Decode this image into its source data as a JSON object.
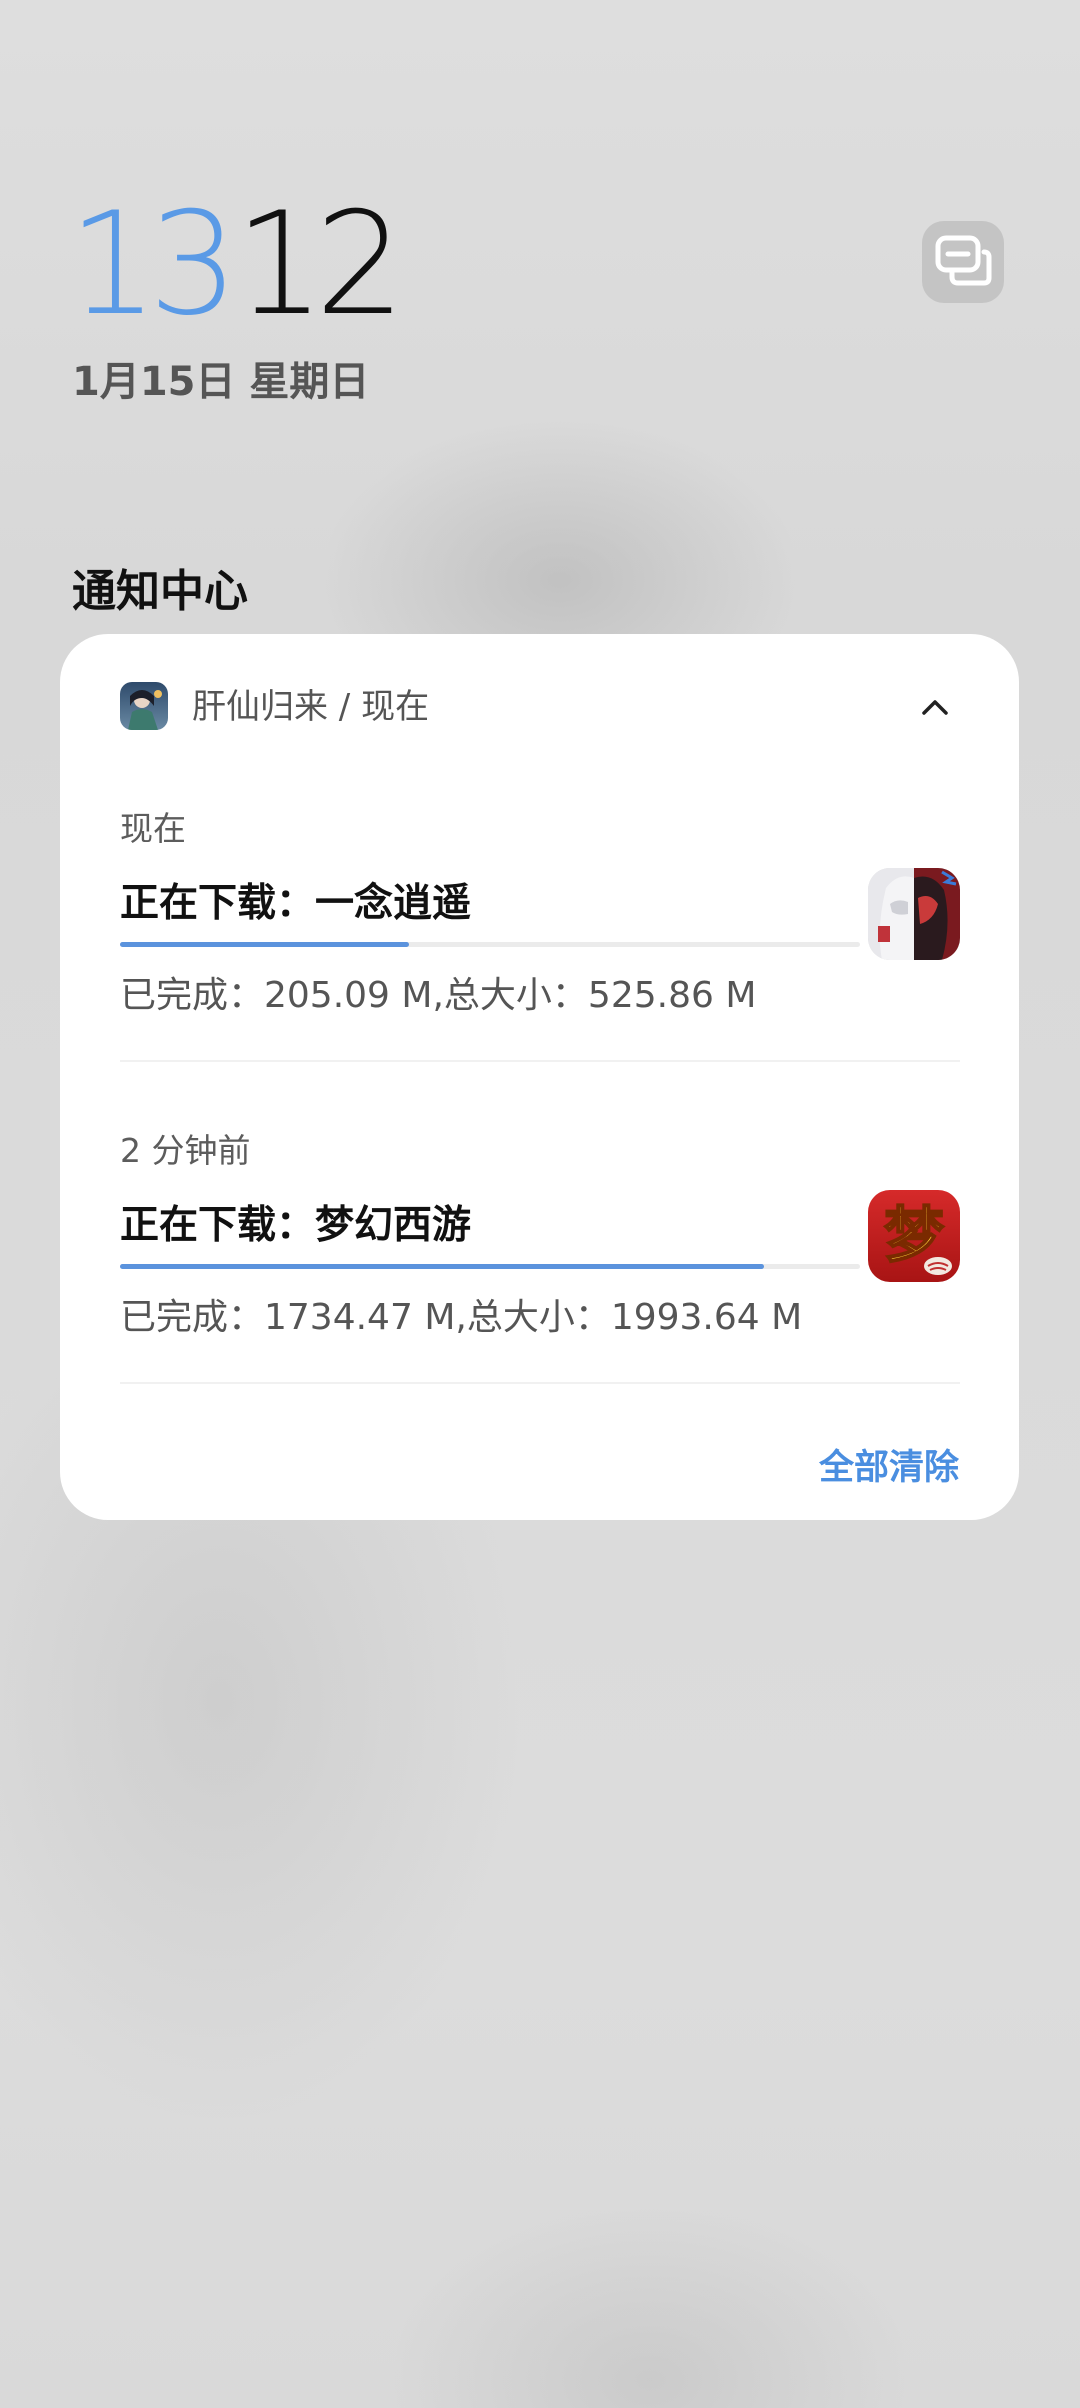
{
  "lockscreen": {
    "clock_hours": "13",
    "clock_minutes": "12",
    "date": "1月15日 星期日",
    "notification_center_title": "通知中心"
  },
  "notification_group": {
    "header_text": "肝仙归来 / 现在",
    "items": [
      {
        "time": "现在",
        "title": "正在下载：一念逍遥",
        "progress": 0.39,
        "detail": "已完成：205.09 M,总大小：525.86 M",
        "thumb_icon": "yinian-xiaoyao-icon"
      },
      {
        "time": "2 分钟前",
        "title": "正在下载：梦幻西游",
        "progress": 0.87,
        "detail": "已完成：1734.47 M,总大小：1993.64 M",
        "thumb_icon": "menghuan-xiyou-icon",
        "thumb_glyph": "梦"
      }
    ],
    "clear_all_label": "全部清除"
  },
  "colors": {
    "accent": "#5b93dd",
    "clock_hours": "#5a9ae6",
    "clear_all": "#4a8ee0"
  }
}
